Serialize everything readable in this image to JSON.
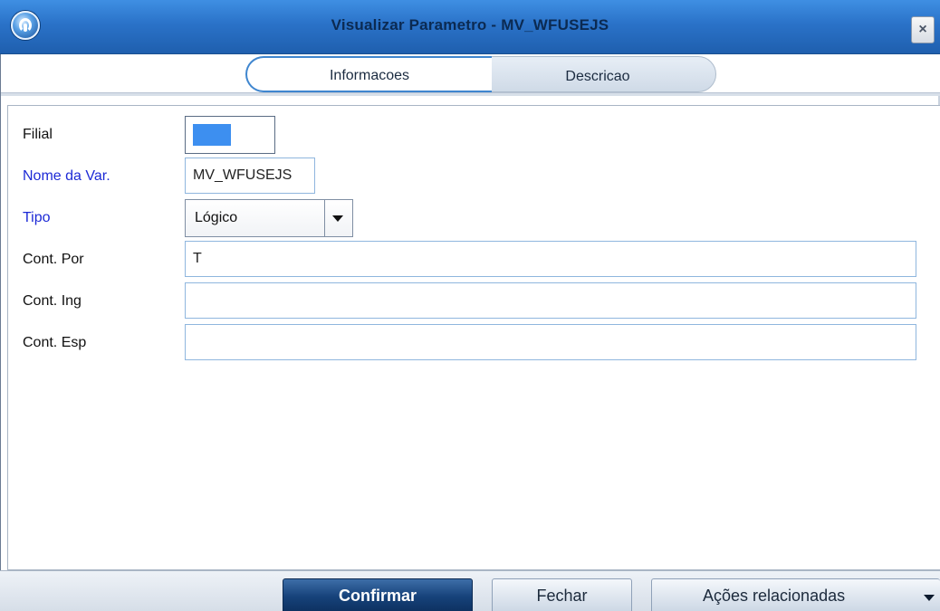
{
  "window": {
    "title": "Visualizar Parametro - MV_WFUSEJS",
    "close_glyph": "×",
    "icon": "app-globe-icon"
  },
  "tabs": [
    {
      "label": "Informacoes",
      "active": true
    },
    {
      "label": "Descricao",
      "active": false
    }
  ],
  "form": {
    "filial": {
      "label": "Filial",
      "value": ""
    },
    "nome_var": {
      "label": "Nome da Var.",
      "value": "MV_WFUSEJS"
    },
    "tipo": {
      "label": "Tipo",
      "value": "Lógico"
    },
    "cont_por": {
      "label": "Cont. Por",
      "value": "T"
    },
    "cont_ing": {
      "label": "Cont. Ing",
      "value": ""
    },
    "cont_esp": {
      "label": "Cont. Esp",
      "value": ""
    }
  },
  "buttons": {
    "confirm": "Confirmar",
    "close": "Fechar",
    "actions": "Ações relacionadas"
  },
  "colors": {
    "title_bar": "#2a72c8",
    "label_required": "#1d2ad6",
    "confirm_button": "#16427a"
  }
}
